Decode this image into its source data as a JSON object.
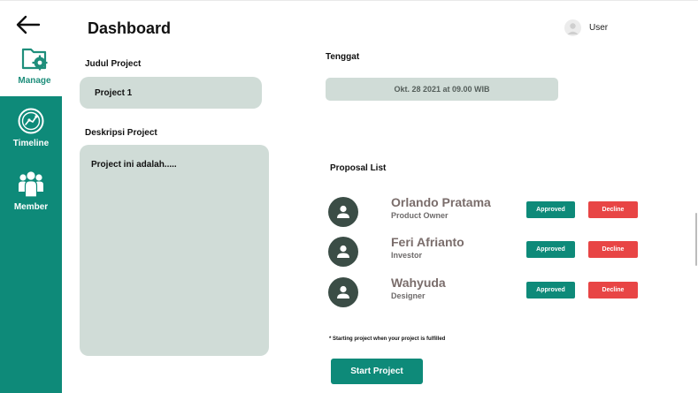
{
  "header": {
    "title": "Dashboard",
    "user_label": "User"
  },
  "nav": {
    "back_icon": "arrow-left-icon",
    "manage_label": "Manage",
    "timeline_label": "Timeline",
    "member_label": "Member"
  },
  "form": {
    "judul_label": "Judul Project",
    "judul_value": "Project 1",
    "deskripsi_label": "Deskripsi Project",
    "deskripsi_value": "Project ini adalah.....",
    "tenggat_label": "Tenggat",
    "tenggat_value": "Okt. 28 2021 at 09.00 WIB"
  },
  "proposals": {
    "title": "Proposal List",
    "items": [
      {
        "name": "Orlando Pratama",
        "role": "Product Owner",
        "approve_label": "Approved",
        "decline_label": "Decline"
      },
      {
        "name": "Feri Afrianto",
        "role": "Investor",
        "approve_label": "Approved",
        "decline_label": "Decline"
      },
      {
        "name": "Wahyuda",
        "role": "Designer",
        "approve_label": "Approved",
        "decline_label": "Decline"
      }
    ]
  },
  "footer": {
    "note": "* Starting project when your project is fulfilled",
    "start_label": "Start Project"
  },
  "colors": {
    "primary": "#0e8a79",
    "decline": "#e84545",
    "field_bg": "#d0dcd7",
    "avatar_dark": "#3b4d46"
  }
}
